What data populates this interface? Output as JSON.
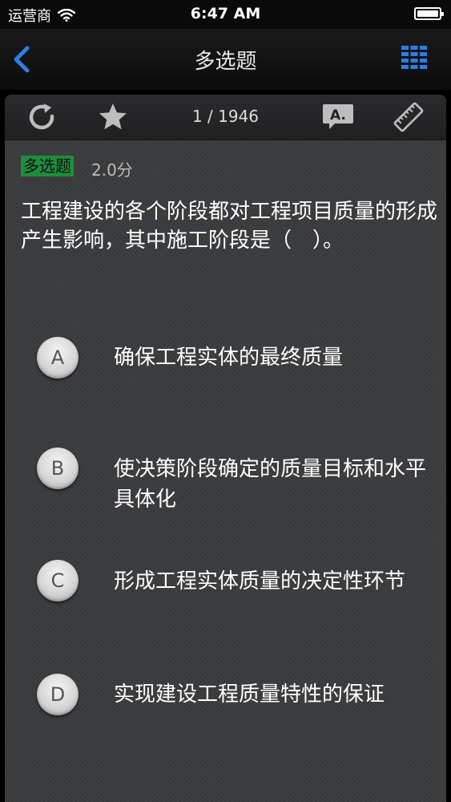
{
  "status_bar": {
    "carrier": "运营商",
    "time": "6:47 AM"
  },
  "nav": {
    "title": "多选题"
  },
  "toolbar": {
    "progress": "1 / 1946"
  },
  "question": {
    "type": "多选题",
    "score": "2.0分",
    "text": "工程建设的各个阶段都对工程项目质量的形成产生影响，其中施工阶段是（　）。"
  },
  "options": [
    {
      "letter": "A",
      "text": "确保工程实体的最终质量"
    },
    {
      "letter": "B",
      "text": "使决策阶段确定的质量目标和水平具体化"
    },
    {
      "letter": "C",
      "text": "形成工程实体质量的决定性环节"
    },
    {
      "letter": "D",
      "text": "实现建设工程质量特性的保证"
    }
  ],
  "icons": {
    "back": "chevron-left-icon",
    "grid": "grid-icon",
    "refresh": "refresh-icon",
    "star": "star-icon",
    "font": "font-bubble-icon",
    "ruler": "ruler-icon"
  },
  "colors": {
    "accent": "#2f7de1",
    "badge": "#1e8d3c"
  }
}
